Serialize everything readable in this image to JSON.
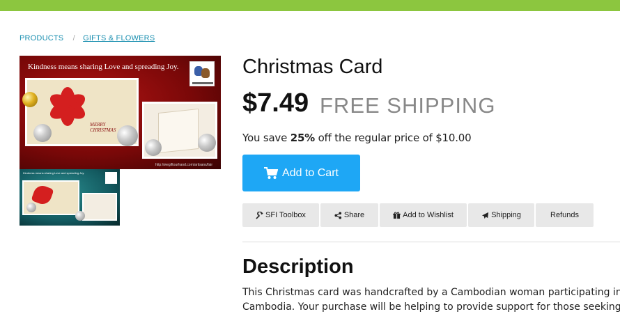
{
  "colors": {
    "top_bar": "#8cc63f",
    "link": "#1a8fb0",
    "cart_button": "#1ea7f5",
    "action_button": "#e8e8e8",
    "shipping_text": "#888888"
  },
  "breadcrumb": {
    "items": [
      "PRODUCTS",
      "GIFTS & FLOWERS"
    ],
    "separator": "/"
  },
  "product_image": {
    "tagline": "Kindness means sharing Love and spreading Joy.",
    "card_text_1": "MERRY",
    "card_text_2": "CHRISTMAS",
    "url_text": "http://wegiftourhand.com/artisans/fair"
  },
  "product": {
    "title": "Christmas Card",
    "price": "$7.49",
    "shipping": "FREE SHIPPING",
    "savings_prefix": "You save ",
    "savings_percent": "25%",
    "savings_suffix": " off the regular price of $10.00"
  },
  "cart_button": {
    "label": "Add to Cart",
    "icon": "cart-icon"
  },
  "actions": [
    {
      "label": "SFI Toolbox",
      "icon": "wrench-icon"
    },
    {
      "label": "Share",
      "icon": "share-icon"
    },
    {
      "label": "Add to Wishlist",
      "icon": "gift-icon"
    },
    {
      "label": "Shipping",
      "icon": "plane-icon"
    },
    {
      "label": "Refunds",
      "icon": ""
    }
  ],
  "description": {
    "heading": "Description",
    "line1": "This Christmas card was handcrafted by a Cambodian woman participating in a livelihood",
    "line2": "Cambodia. Your purchase will be helping to provide support for those seeking to improve"
  }
}
